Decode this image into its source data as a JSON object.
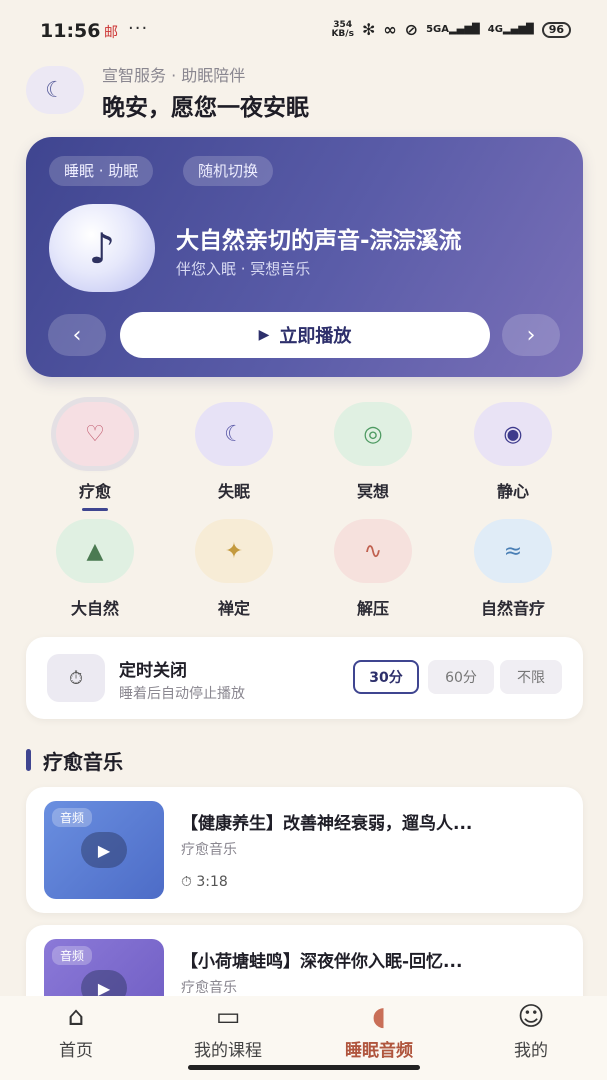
{
  "status_bar": {
    "time": "11:56",
    "left_icon": "mail-notify-icon",
    "dots": "···",
    "speed": "354",
    "speed_unit": "KB/s",
    "network": "5GA",
    "network2": "4G",
    "battery": "96"
  },
  "header": {
    "subtitle": "宣智服务 · 助眠陪伴",
    "title": "晚安，愿您一夜安眠",
    "avatar_icon": "moon-icon"
  },
  "hero": {
    "chip1": "睡眠 · 助眠",
    "chip2": "随机切换",
    "title": "大自然亲切的声音-淙淙溪流",
    "subtitle": "伴您入眠 · 冥想音乐",
    "play_label": "立即播放",
    "prev": "‹",
    "next": "›",
    "note_icon": "♪"
  },
  "categories": [
    {
      "label": "疗愈",
      "icon": "♡",
      "color": "#f6dfe3",
      "icon_color": "#c05a6e",
      "active": true
    },
    {
      "label": "失眠",
      "icon": "☾",
      "color": "#e7e2f6",
      "icon_color": "#5b5aa8"
    },
    {
      "label": "冥想",
      "icon": "◎",
      "color": "#e0f0e2",
      "icon_color": "#4e9a62"
    },
    {
      "label": "静心",
      "icon": "◉",
      "color": "#e9e3f5",
      "icon_color": "#3d3a8c"
    },
    {
      "label": "大自然",
      "icon": "▲",
      "color": "#e0f0e2",
      "icon_color": "#4b7a52"
    },
    {
      "label": "禅定",
      "icon": "✦",
      "color": "#f7ecd6",
      "icon_color": "#c49a3e"
    },
    {
      "label": "解压",
      "icon": "∿",
      "color": "#f6e1dd",
      "icon_color": "#c0604f"
    },
    {
      "label": "自然音疗",
      "icon": "≈",
      "color": "#e0ecf7",
      "icon_color": "#4a7fb5"
    }
  ],
  "timer": {
    "title": "定时关闭",
    "subtitle": "睡着后自动停止播放",
    "icon": "⏱",
    "options": [
      "30分",
      "60分",
      "不限"
    ],
    "selected": "30分"
  },
  "section": {
    "title": "疗愈音乐"
  },
  "items": [
    {
      "title": "【健康养生】改善神经衰弱，遛鸟人...",
      "tag": "音频",
      "category": "疗愈音乐",
      "duration": "3:18"
    },
    {
      "title": "【小荷塘蛙鸣】深夜伴你入眠-回忆...",
      "tag": "音频",
      "category": "疗愈音乐"
    }
  ],
  "bottom_nav": [
    {
      "label": "首页",
      "icon": "home-icon"
    },
    {
      "label": "我的课程",
      "icon": "book-icon"
    },
    {
      "label": "睡眠音频",
      "icon": "sound-wave-icon",
      "active": true
    },
    {
      "label": "我的",
      "icon": "profile-icon"
    }
  ]
}
